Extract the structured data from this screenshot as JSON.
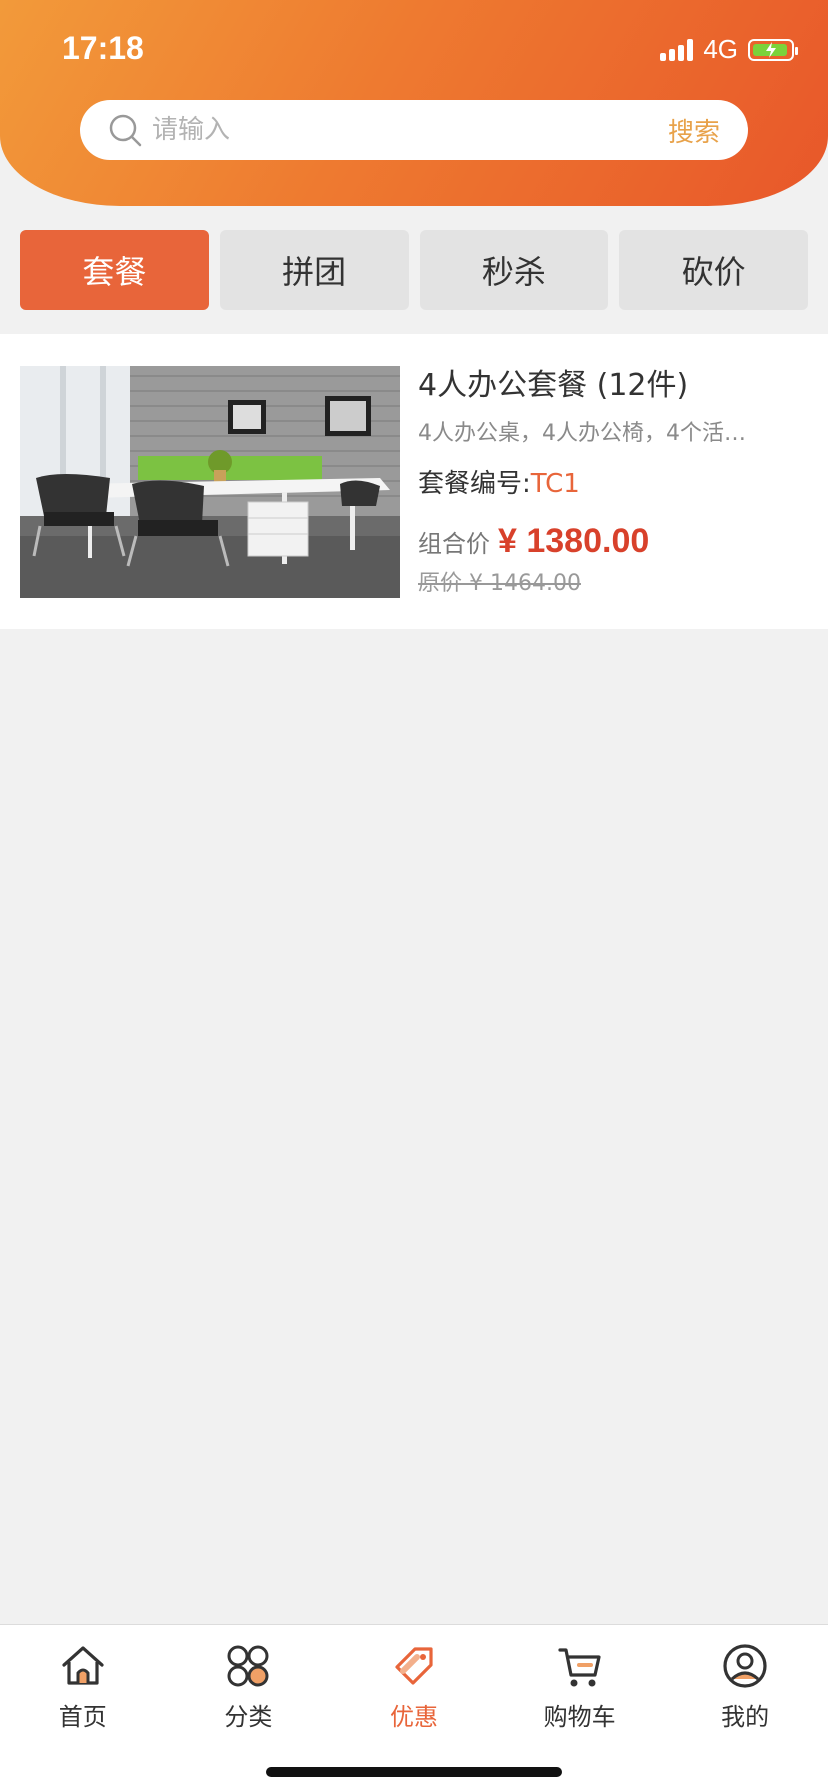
{
  "status_bar": {
    "time": "17:18",
    "network": "4G"
  },
  "search": {
    "placeholder": "请输入",
    "button_label": "搜索"
  },
  "tabs": [
    {
      "label": "套餐",
      "active": true
    },
    {
      "label": "拼团",
      "active": false
    },
    {
      "label": "秒杀",
      "active": false
    },
    {
      "label": "砍价",
      "active": false
    }
  ],
  "product": {
    "title": "4人办公套餐 (12件)",
    "description": "4人办公桌，4人办公椅，4个活…",
    "code_label": "套餐编号:",
    "code": "TC1",
    "price_label": "组合价",
    "price": "¥ 1380.00",
    "original_price": "原价 ¥ 1464.00"
  },
  "bottom_nav": [
    {
      "label": "首页",
      "icon": "home-icon",
      "active": false
    },
    {
      "label": "分类",
      "icon": "category-icon",
      "active": false
    },
    {
      "label": "优惠",
      "icon": "discount-tag-icon",
      "active": true
    },
    {
      "label": "购物车",
      "icon": "cart-icon",
      "active": false
    },
    {
      "label": "我的",
      "icon": "user-icon",
      "active": false
    }
  ],
  "colors": {
    "accent": "#e8653a",
    "price": "#d8412b",
    "search_button": "#e8a24a"
  }
}
